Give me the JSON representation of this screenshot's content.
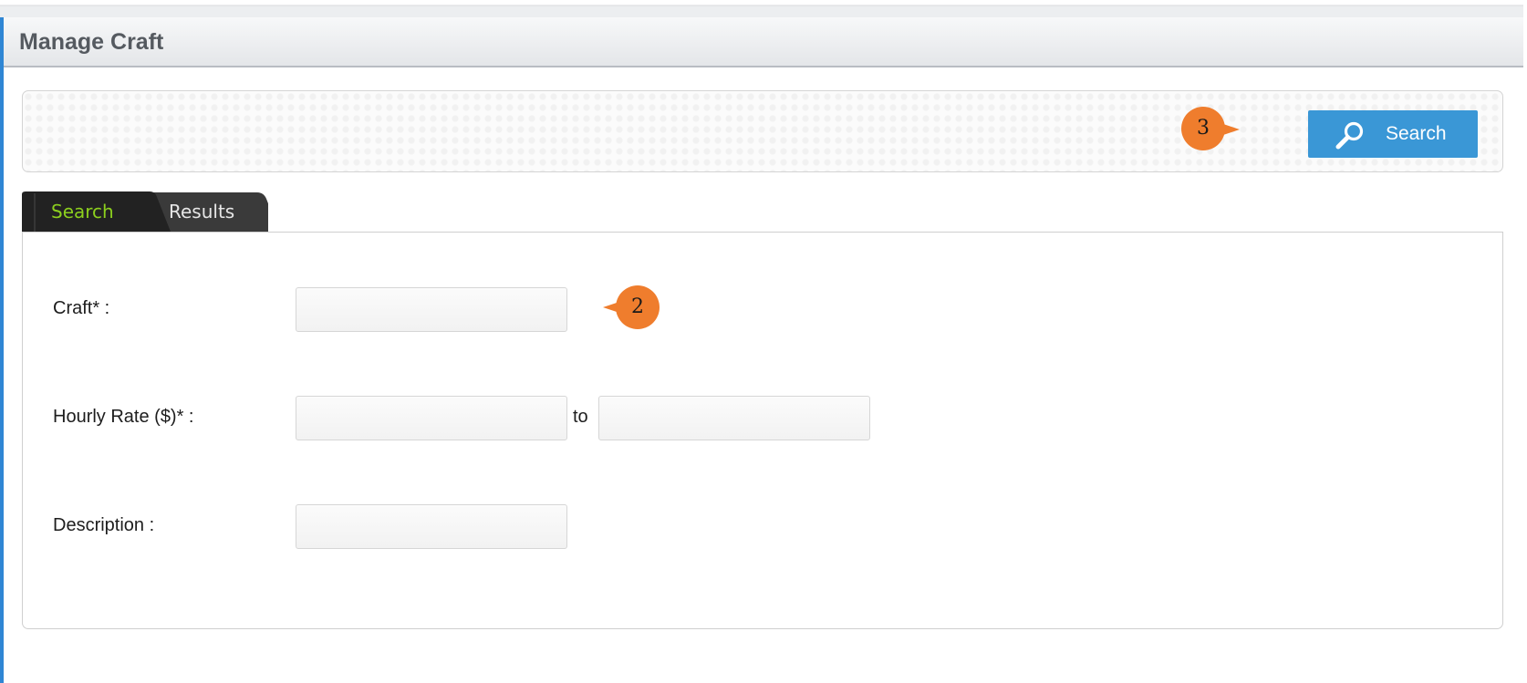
{
  "header": {
    "title": "Manage Craft"
  },
  "toolbar": {
    "search_label": "Search"
  },
  "callouts": {
    "search_callout": "3",
    "craft_callout": "2"
  },
  "tabs": [
    {
      "label": "Search",
      "active": true
    },
    {
      "label": "Results",
      "active": false
    }
  ],
  "form": {
    "craft_label": "Craft* :",
    "craft_value": "",
    "hourly_rate_label": "Hourly Rate ($)* :",
    "hourly_rate_from_value": "",
    "to_label": "to",
    "hourly_rate_to_value": "",
    "description_label": "Description :",
    "description_value": ""
  },
  "colors": {
    "accent": "#3a97d6",
    "callout": "#ef7d2d",
    "active_tab_text": "#8ccf1e",
    "tab_background": "#2a2a2a"
  }
}
